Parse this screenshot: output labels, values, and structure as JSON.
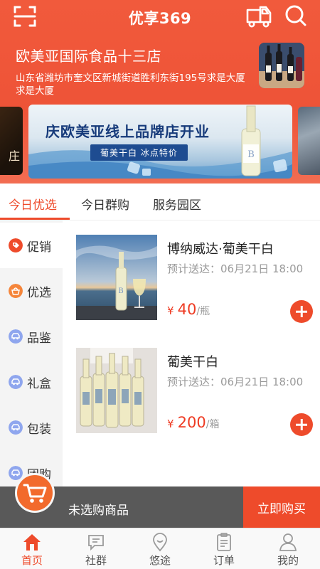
{
  "header": {
    "app_title": "优享369",
    "store_name": "欧美亚国际食品十三店",
    "store_address": "山东省潍坊市奎文区新城街道胜利东街195号求是大厦 求是大厦"
  },
  "banners": {
    "left_partial_text": "庄",
    "main_title": "庆欧美亚线上品牌店开业",
    "main_subtitle": "葡美干白  冰点特价"
  },
  "tabs": [
    {
      "label": "今日优选",
      "active": true
    },
    {
      "label": "今日群购",
      "active": false
    },
    {
      "label": "服务园区",
      "active": false
    }
  ],
  "sidebar": {
    "items": [
      {
        "label": "促销",
        "icon": "tag-icon",
        "color": "#ee4b2b"
      },
      {
        "label": "优选",
        "icon": "basket-icon",
        "color": "#f5853a"
      },
      {
        "label": "品鉴",
        "icon": "car-icon",
        "color": "#8fa6ee"
      },
      {
        "label": "礼盒",
        "icon": "car-icon",
        "color": "#8fa6ee"
      },
      {
        "label": "包装",
        "icon": "car-icon",
        "color": "#8fa6ee"
      },
      {
        "label": "团购",
        "icon": "car-icon",
        "color": "#8fa6ee"
      }
    ]
  },
  "products": [
    {
      "name": "博纳威达·葡美干白",
      "eta": "预计送达：06月21日 18:00",
      "currency": "¥",
      "price": "40",
      "unit": "/瓶"
    },
    {
      "name": "葡美干白",
      "eta": "预计送达：06月21日 18:00",
      "currency": "¥",
      "price": "200",
      "unit": "/箱"
    }
  ],
  "cart": {
    "empty_text": "未选购商品",
    "buy_label": "立即购买"
  },
  "bottom_nav": [
    {
      "label": "首页",
      "icon": "home-icon",
      "active": true
    },
    {
      "label": "社群",
      "icon": "chat-icon",
      "active": false
    },
    {
      "label": "悠途",
      "icon": "location-icon",
      "active": false
    },
    {
      "label": "订单",
      "icon": "order-icon",
      "active": false
    },
    {
      "label": "我的",
      "icon": "profile-icon",
      "active": false
    }
  ],
  "colors": {
    "brand": "#ee4b2b",
    "cart_bar": "#595959",
    "sidebar_bg": "#f4f4f4"
  }
}
